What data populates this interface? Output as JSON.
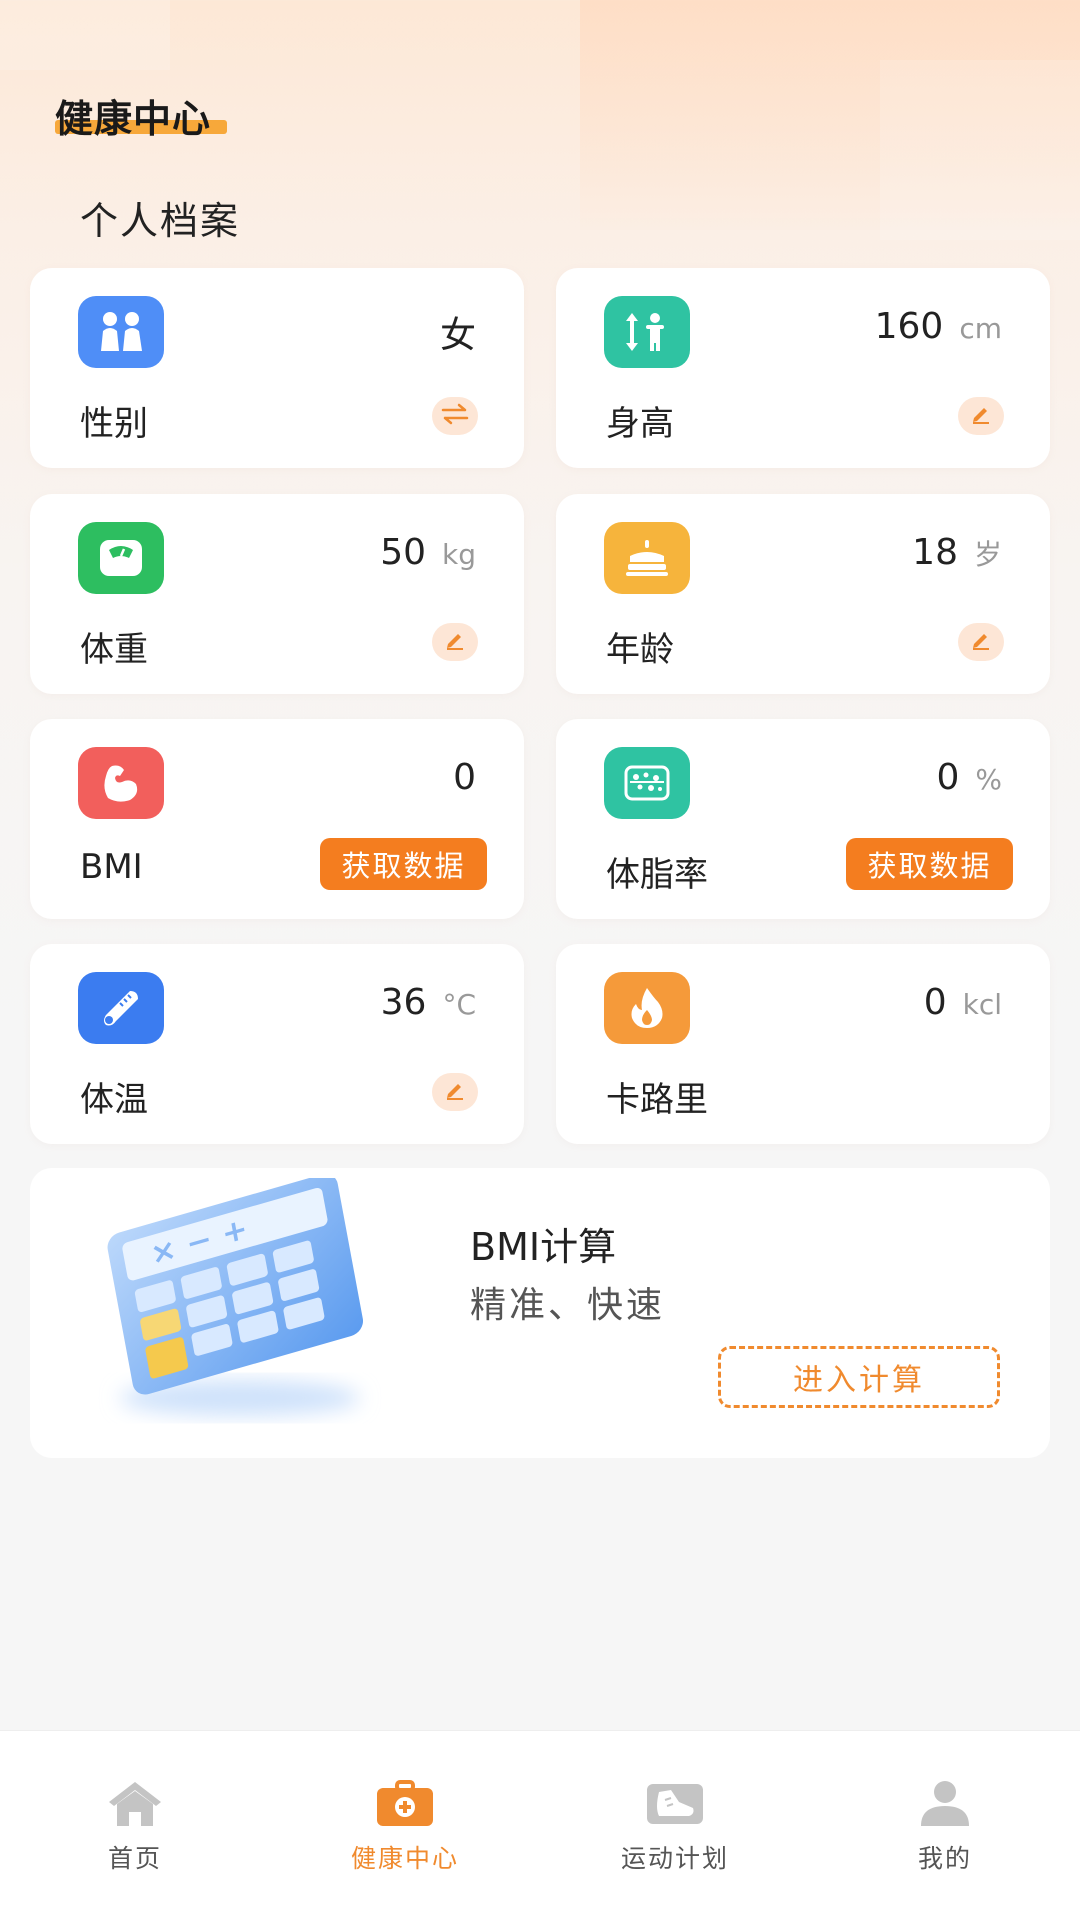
{
  "header": {
    "title": "健康中心",
    "section": "个人档案"
  },
  "colors": {
    "accent": "#f47d1f",
    "gender_icon": "#4f8ef7",
    "height_icon": "#2fc3a2",
    "weight_icon": "#2dbe60",
    "age_icon": "#f6b43c",
    "bmi_icon": "#f25f5c",
    "fat_icon": "#2fc3a2",
    "temp_icon": "#3b7cf0",
    "calorie_icon": "#f59a3a"
  },
  "cards": {
    "gender": {
      "label": "性别",
      "value": "女",
      "unit": "",
      "icon": "people-icon",
      "action": "swap-icon"
    },
    "height": {
      "label": "身高",
      "value": "160",
      "unit": "cm",
      "icon": "height-icon",
      "action": "edit-icon"
    },
    "weight": {
      "label": "体重",
      "value": "50",
      "unit": "kg",
      "icon": "scale-icon",
      "action": "edit-icon"
    },
    "age": {
      "label": "年龄",
      "value": "18",
      "unit": "岁",
      "icon": "cake-icon",
      "action": "edit-icon"
    },
    "bmi": {
      "label": "BMI",
      "value": "0",
      "unit": "",
      "icon": "muscle-icon",
      "button": "获取数据"
    },
    "bodyfat": {
      "label": "体脂率",
      "value": "0",
      "unit": "%",
      "icon": "bodyfat-icon",
      "button": "获取数据"
    },
    "temperature": {
      "label": "体温",
      "value": "36",
      "unit": "°C",
      "icon": "thermometer-icon",
      "action": "edit-icon"
    },
    "calorie": {
      "label": "卡路里",
      "value": "0",
      "unit": "kcl",
      "icon": "flame-icon"
    }
  },
  "bmi_banner": {
    "title": "BMI计算",
    "subtitle": "精准、快速",
    "button": "进入计算",
    "icon": "calculator-icon"
  },
  "tabbar": {
    "items": [
      {
        "label": "首页",
        "icon": "home-icon",
        "active": false
      },
      {
        "label": "健康中心",
        "icon": "medical-kit-icon",
        "active": true
      },
      {
        "label": "运动计划",
        "icon": "sneaker-icon",
        "active": false
      },
      {
        "label": "我的",
        "icon": "user-icon",
        "active": false
      }
    ]
  }
}
